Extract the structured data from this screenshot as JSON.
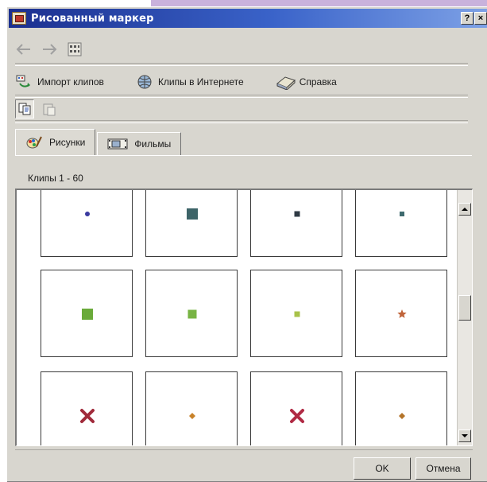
{
  "window": {
    "title": "Рисованный маркер",
    "help_button": "?",
    "close_button": "×"
  },
  "toolbar": {
    "back_icon": "back-arrow-icon",
    "forward_icon": "forward-arrow-icon",
    "view_icon": "grid-view-icon",
    "import_label": "Импорт клипов",
    "online_label": "Клипы в Интернете",
    "help_label": "Справка"
  },
  "tabs": [
    {
      "label": "Рисунки",
      "active": true
    },
    {
      "label": "Фильмы",
      "active": false
    }
  ],
  "clips_count": "Клипы 1 - 60",
  "scrollbar_position": 0.45,
  "markers": [
    {
      "shape": "circle",
      "color": "#3a3aa0"
    },
    {
      "shape": "square",
      "color": "#3d6468"
    },
    {
      "shape": "square",
      "color": "#2f3a44"
    },
    {
      "shape": "square",
      "color": "#3e6a6e"
    },
    {
      "shape": "square",
      "color": "#6aaa3a"
    },
    {
      "shape": "square",
      "color": "#78b444"
    },
    {
      "shape": "square",
      "color": "#a8c24a"
    },
    {
      "shape": "star",
      "color": "#c0643a"
    },
    {
      "shape": "cross",
      "color": "#a02a3a"
    },
    {
      "shape": "diamond",
      "color": "#c8822a"
    },
    {
      "shape": "cross",
      "color": "#b02a44"
    },
    {
      "shape": "diamond",
      "color": "#b4742a"
    }
  ],
  "buttons": {
    "ok": "OK",
    "cancel": "Отмена"
  },
  "colors": {
    "title_bar_start": "#1b2f8f",
    "title_bar_end": "#7da1e6",
    "dialog_bg": "#d8d6cf"
  }
}
